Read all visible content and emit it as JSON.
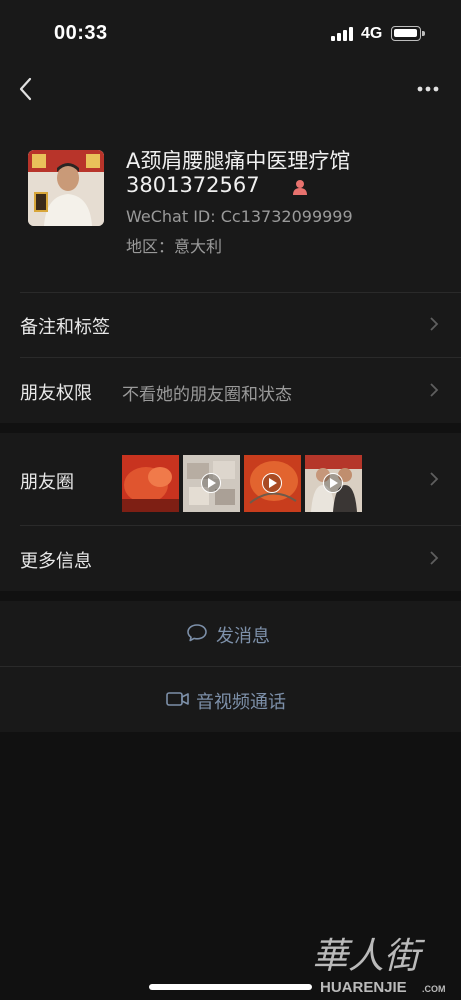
{
  "status_bar": {
    "time": "00:33",
    "network": "4G",
    "icons": [
      "signal-icon",
      "battery-icon"
    ]
  },
  "nav": {
    "back_icon": "chevron-left-icon",
    "more_icon": "ellipsis-icon"
  },
  "profile": {
    "name_line1": "A颈肩腰腿痛中医理疗馆",
    "name_line2": "3801372567",
    "gender_icon": "female-user-icon",
    "wechat_id": "WeChat ID: Cc13732099999",
    "region": "地区：意大利"
  },
  "rows": {
    "remark_tags": {
      "label": "备注和标签"
    },
    "moments_permission": {
      "label": "朋友权限",
      "value": "不看她的朋友圈和状态"
    },
    "moments": {
      "label": "朋友圈",
      "thumbnails": [
        {
          "kind": "image",
          "color": "#d0412a"
        },
        {
          "kind": "video",
          "color": "#cfc8bf"
        },
        {
          "kind": "video",
          "color": "#d24a22"
        },
        {
          "kind": "video",
          "color": "#c9b8a6"
        }
      ]
    },
    "more_info": {
      "label": "更多信息"
    }
  },
  "actions": {
    "message": {
      "label": "发消息",
      "icon": "chat-bubble-icon"
    },
    "call": {
      "label": "音视频通话",
      "icon": "video-camera-icon"
    }
  },
  "watermark": {
    "brand_cn": "華人街",
    "brand_en": "HUARENJIE",
    "domain": ".COM"
  },
  "colors": {
    "background": "#111111",
    "card": "#191919",
    "primary_text": "#e8e8e8",
    "secondary_text": "#9a9a9a",
    "link_text": "#7d90a9",
    "female_accent": "#e8726e"
  }
}
